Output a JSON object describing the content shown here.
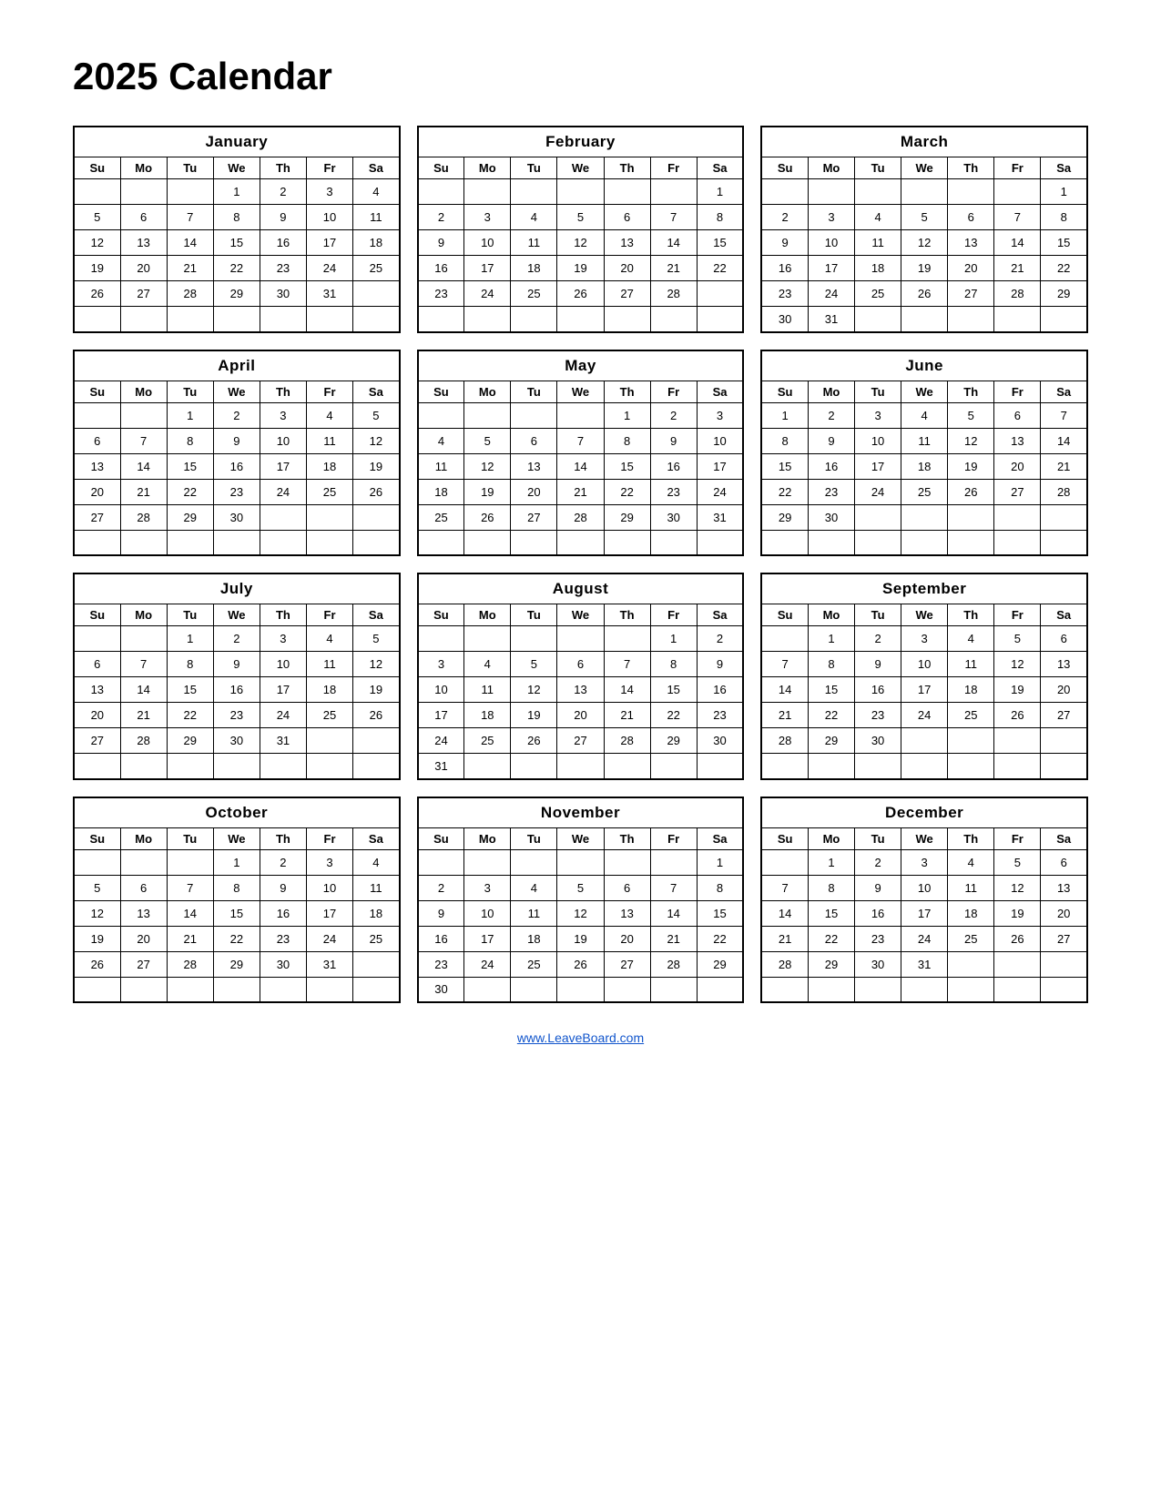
{
  "title": "2025 Calendar",
  "footer_link": "www.LeaveBoard.com",
  "day_headers": [
    "Su",
    "Mo",
    "Tu",
    "We",
    "Th",
    "Fr",
    "Sa"
  ],
  "months": [
    {
      "name": "January",
      "weeks": [
        [
          "",
          "",
          "",
          "1",
          "2",
          "3",
          "4"
        ],
        [
          "5",
          "6",
          "7",
          "8",
          "9",
          "10",
          "11"
        ],
        [
          "12",
          "13",
          "14",
          "15",
          "16",
          "17",
          "18"
        ],
        [
          "19",
          "20",
          "21",
          "22",
          "23",
          "24",
          "25"
        ],
        [
          "26",
          "27",
          "28",
          "29",
          "30",
          "31",
          ""
        ],
        [
          "",
          "",
          "",
          "",
          "",
          "",
          ""
        ]
      ]
    },
    {
      "name": "February",
      "weeks": [
        [
          "",
          "",
          "",
          "",
          "",
          "",
          "1"
        ],
        [
          "2",
          "3",
          "4",
          "5",
          "6",
          "7",
          "8"
        ],
        [
          "9",
          "10",
          "11",
          "12",
          "13",
          "14",
          "15"
        ],
        [
          "16",
          "17",
          "18",
          "19",
          "20",
          "21",
          "22"
        ],
        [
          "23",
          "24",
          "25",
          "26",
          "27",
          "28",
          ""
        ],
        [
          "",
          "",
          "",
          "",
          "",
          "",
          ""
        ]
      ]
    },
    {
      "name": "March",
      "weeks": [
        [
          "",
          "",
          "",
          "",
          "",
          "",
          "1"
        ],
        [
          "2",
          "3",
          "4",
          "5",
          "6",
          "7",
          "8"
        ],
        [
          "9",
          "10",
          "11",
          "12",
          "13",
          "14",
          "15"
        ],
        [
          "16",
          "17",
          "18",
          "19",
          "20",
          "21",
          "22"
        ],
        [
          "23",
          "24",
          "25",
          "26",
          "27",
          "28",
          "29"
        ],
        [
          "30",
          "31",
          "",
          "",
          "",
          "",
          ""
        ]
      ]
    },
    {
      "name": "April",
      "weeks": [
        [
          "",
          "",
          "1",
          "2",
          "3",
          "4",
          "5"
        ],
        [
          "6",
          "7",
          "8",
          "9",
          "10",
          "11",
          "12"
        ],
        [
          "13",
          "14",
          "15",
          "16",
          "17",
          "18",
          "19"
        ],
        [
          "20",
          "21",
          "22",
          "23",
          "24",
          "25",
          "26"
        ],
        [
          "27",
          "28",
          "29",
          "30",
          "",
          "",
          ""
        ],
        [
          "",
          "",
          "",
          "",
          "",
          "",
          ""
        ]
      ]
    },
    {
      "name": "May",
      "weeks": [
        [
          "",
          "",
          "",
          "",
          "1",
          "2",
          "3"
        ],
        [
          "4",
          "5",
          "6",
          "7",
          "8",
          "9",
          "10"
        ],
        [
          "11",
          "12",
          "13",
          "14",
          "15",
          "16",
          "17"
        ],
        [
          "18",
          "19",
          "20",
          "21",
          "22",
          "23",
          "24"
        ],
        [
          "25",
          "26",
          "27",
          "28",
          "29",
          "30",
          "31"
        ],
        [
          "",
          "",
          "",
          "",
          "",
          "",
          ""
        ]
      ]
    },
    {
      "name": "June",
      "weeks": [
        [
          "1",
          "2",
          "3",
          "4",
          "5",
          "6",
          "7"
        ],
        [
          "8",
          "9",
          "10",
          "11",
          "12",
          "13",
          "14"
        ],
        [
          "15",
          "16",
          "17",
          "18",
          "19",
          "20",
          "21"
        ],
        [
          "22",
          "23",
          "24",
          "25",
          "26",
          "27",
          "28"
        ],
        [
          "29",
          "30",
          "",
          "",
          "",
          "",
          ""
        ],
        [
          "",
          "",
          "",
          "",
          "",
          "",
          ""
        ]
      ]
    },
    {
      "name": "July",
      "weeks": [
        [
          "",
          "",
          "1",
          "2",
          "3",
          "4",
          "5"
        ],
        [
          "6",
          "7",
          "8",
          "9",
          "10",
          "11",
          "12"
        ],
        [
          "13",
          "14",
          "15",
          "16",
          "17",
          "18",
          "19"
        ],
        [
          "20",
          "21",
          "22",
          "23",
          "24",
          "25",
          "26"
        ],
        [
          "27",
          "28",
          "29",
          "30",
          "31",
          "",
          ""
        ],
        [
          "",
          "",
          "",
          "",
          "",
          "",
          ""
        ]
      ]
    },
    {
      "name": "August",
      "weeks": [
        [
          "",
          "",
          "",
          "",
          "",
          "1",
          "2"
        ],
        [
          "3",
          "4",
          "5",
          "6",
          "7",
          "8",
          "9"
        ],
        [
          "10",
          "11",
          "12",
          "13",
          "14",
          "15",
          "16"
        ],
        [
          "17",
          "18",
          "19",
          "20",
          "21",
          "22",
          "23"
        ],
        [
          "24",
          "25",
          "26",
          "27",
          "28",
          "29",
          "30"
        ],
        [
          "31",
          "",
          "",
          "",
          "",
          "",
          ""
        ]
      ]
    },
    {
      "name": "September",
      "weeks": [
        [
          "",
          "1",
          "2",
          "3",
          "4",
          "5",
          "6"
        ],
        [
          "7",
          "8",
          "9",
          "10",
          "11",
          "12",
          "13"
        ],
        [
          "14",
          "15",
          "16",
          "17",
          "18",
          "19",
          "20"
        ],
        [
          "21",
          "22",
          "23",
          "24",
          "25",
          "26",
          "27"
        ],
        [
          "28",
          "29",
          "30",
          "",
          "",
          "",
          ""
        ],
        [
          "",
          "",
          "",
          "",
          "",
          "",
          ""
        ]
      ]
    },
    {
      "name": "October",
      "weeks": [
        [
          "",
          "",
          "",
          "1",
          "2",
          "3",
          "4"
        ],
        [
          "5",
          "6",
          "7",
          "8",
          "9",
          "10",
          "11"
        ],
        [
          "12",
          "13",
          "14",
          "15",
          "16",
          "17",
          "18"
        ],
        [
          "19",
          "20",
          "21",
          "22",
          "23",
          "24",
          "25"
        ],
        [
          "26",
          "27",
          "28",
          "29",
          "30",
          "31",
          ""
        ],
        [
          "",
          "",
          "",
          "",
          "",
          "",
          ""
        ]
      ]
    },
    {
      "name": "November",
      "weeks": [
        [
          "",
          "",
          "",
          "",
          "",
          "",
          "1"
        ],
        [
          "2",
          "3",
          "4",
          "5",
          "6",
          "7",
          "8"
        ],
        [
          "9",
          "10",
          "11",
          "12",
          "13",
          "14",
          "15"
        ],
        [
          "16",
          "17",
          "18",
          "19",
          "20",
          "21",
          "22"
        ],
        [
          "23",
          "24",
          "25",
          "26",
          "27",
          "28",
          "29"
        ],
        [
          "30",
          "",
          "",
          "",
          "",
          "",
          ""
        ]
      ]
    },
    {
      "name": "December",
      "weeks": [
        [
          "",
          "1",
          "2",
          "3",
          "4",
          "5",
          "6"
        ],
        [
          "7",
          "8",
          "9",
          "10",
          "11",
          "12",
          "13"
        ],
        [
          "14",
          "15",
          "16",
          "17",
          "18",
          "19",
          "20"
        ],
        [
          "21",
          "22",
          "23",
          "24",
          "25",
          "26",
          "27"
        ],
        [
          "28",
          "29",
          "30",
          "31",
          "",
          "",
          ""
        ],
        [
          "",
          "",
          "",
          "",
          "",
          "",
          ""
        ]
      ]
    }
  ]
}
